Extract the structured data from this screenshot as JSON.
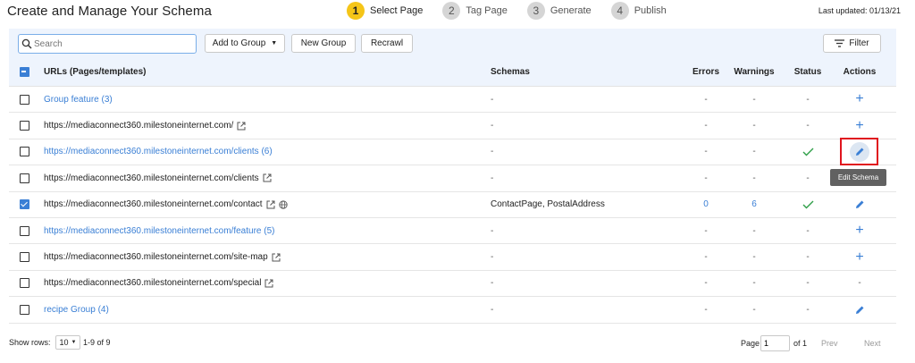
{
  "header": {
    "title": "Create and Manage Your Schema",
    "steps": [
      {
        "num": "1",
        "label": "Select Page"
      },
      {
        "num": "2",
        "label": "Tag Page"
      },
      {
        "num": "3",
        "label": "Generate"
      },
      {
        "num": "4",
        "label": "Publish"
      }
    ],
    "last_updated": "Last updated: 01/13/21"
  },
  "toolbar": {
    "search_placeholder": "Search",
    "add_to_group": "Add to Group",
    "new_group": "New Group",
    "recrawl": "Recrawl",
    "filter": "Filter"
  },
  "table": {
    "headers": {
      "urls": "URLs (Pages/templates)",
      "schemas": "Schemas",
      "errors": "Errors",
      "warnings": "Warnings",
      "status": "Status",
      "actions": "Actions"
    },
    "rows": [
      {
        "url": "Group feature (3)",
        "schemas": "-",
        "errors": "-",
        "warnings": "-",
        "status": "-"
      },
      {
        "url": "https://mediaconnect360.milestoneinternet.com/",
        "schemas": "-",
        "errors": "-",
        "warnings": "-",
        "status": "-"
      },
      {
        "url": "https://mediaconnect360.milestoneinternet.com/clients (6)",
        "schemas": "-",
        "errors": "-",
        "warnings": "-",
        "status": "check"
      },
      {
        "url": "https://mediaconnect360.milestoneinternet.com/clients",
        "schemas": "-",
        "errors": "-",
        "warnings": "-",
        "status": "-"
      },
      {
        "url": "https://mediaconnect360.milestoneinternet.com/contact",
        "schemas": "ContactPage, PostalAddress",
        "errors": "0",
        "warnings": "6",
        "status": "check"
      },
      {
        "url": "https://mediaconnect360.milestoneinternet.com/feature (5)",
        "schemas": "-",
        "errors": "-",
        "warnings": "-",
        "status": "-"
      },
      {
        "url": "https://mediaconnect360.milestoneinternet.com/site-map",
        "schemas": "-",
        "errors": "-",
        "warnings": "-",
        "status": "-"
      },
      {
        "url": "https://mediaconnect360.milestoneinternet.com/special",
        "schemas": "-",
        "errors": "-",
        "warnings": "-",
        "status": "-"
      },
      {
        "url": "recipe Group (4)",
        "schemas": "-",
        "errors": "-",
        "warnings": "-",
        "status": "-"
      }
    ],
    "last_row_actions": "-"
  },
  "tooltip": "Edit Schema",
  "footer": {
    "show_rows_label": "Show rows:",
    "rows_value": "10",
    "range": "1-9 of 9",
    "page_label": "Page",
    "page_value": "1",
    "of_label": "of 1",
    "prev": "Prev",
    "next": "Next"
  },
  "colors": {
    "accent": "#3a7fd5",
    "active_step": "#f5c518",
    "success": "#2e9e47",
    "highlight": "#e0141e"
  }
}
